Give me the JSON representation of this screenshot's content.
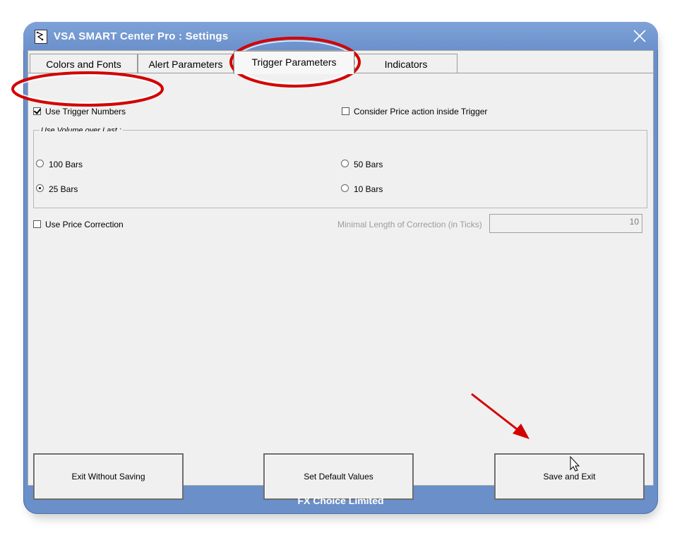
{
  "window": {
    "title": "VSA SMART Center Pro : Settings"
  },
  "tabs": [
    {
      "label": "Colors and Fonts",
      "active": false
    },
    {
      "label": "Alert Parameters",
      "active": false
    },
    {
      "label": "Trigger Parameters",
      "active": true
    },
    {
      "label": "Indicators",
      "active": false
    }
  ],
  "options": {
    "use_trigger_numbers": {
      "label": "Use Trigger Numbers",
      "checked": true
    },
    "consider_price_action": {
      "label": "Consider Price action inside Trigger",
      "checked": false
    },
    "use_price_correction": {
      "label": "Use Price Correction",
      "checked": false
    }
  },
  "volume_group": {
    "title": "Use Volume over Last :",
    "radios": [
      {
        "label": "100 Bars",
        "selected": false
      },
      {
        "label": "50 Bars",
        "selected": false
      },
      {
        "label": "25 Bars",
        "selected": true
      },
      {
        "label": "10 Bars",
        "selected": false
      }
    ]
  },
  "correction": {
    "label": "Minimal Length of Correction (in Ticks)",
    "value": "10"
  },
  "buttons": {
    "exit_without_saving": "Exit Without Saving",
    "set_default_values": "Set Default Values",
    "save_and_exit": "Save and Exit"
  },
  "footer": {
    "text": "FX Choice Limited"
  },
  "colors": {
    "titlebar": "#6b90cb",
    "client_bg": "#f0f0f0",
    "annotation_red": "#d40000"
  }
}
